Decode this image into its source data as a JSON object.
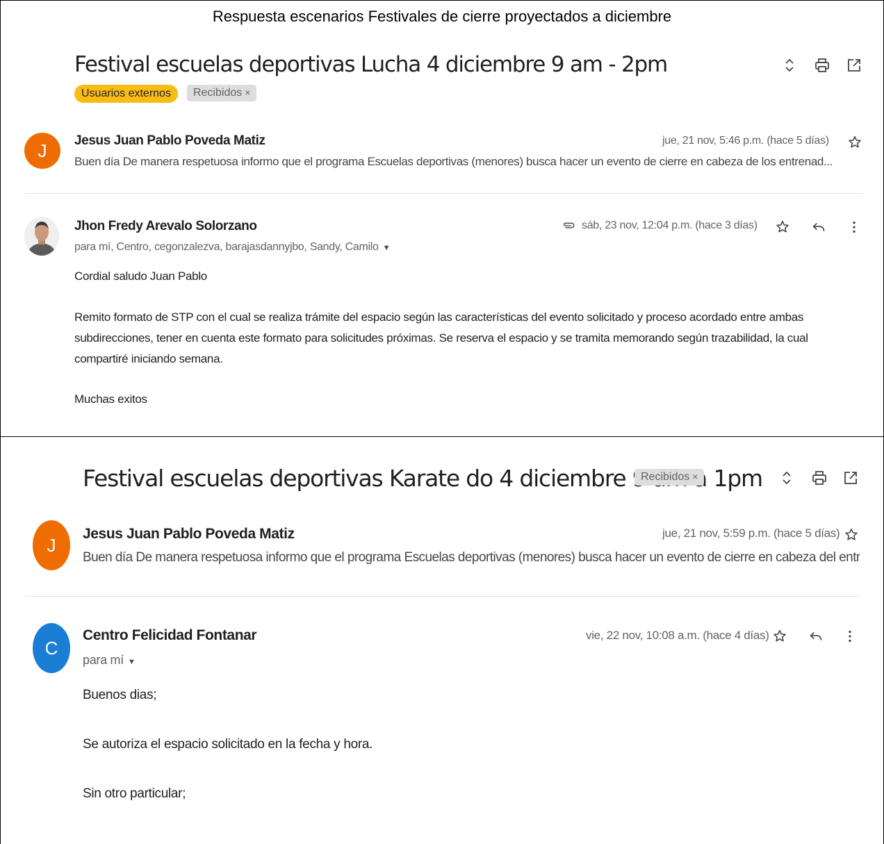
{
  "document_title": "Respuesta escenarios Festivales de cierre proyectados a diciembre",
  "thread1": {
    "subject": "Festival escuelas deportivas Lucha 4 diciembre 9 am - 2pm",
    "labels": {
      "external": "Usuarios externos",
      "inbox": "Recibidos",
      "remove": "×"
    },
    "messages": [
      {
        "avatar_letter": "J",
        "sender": "Jesus Juan Pablo Poveda Matiz",
        "date": "jue, 21 nov, 5:46 p.m. (hace 5 días)",
        "snippet": "Buen día De manera respetuosa informo que el programa Escuelas deportivas (menores) busca hacer un evento de cierre en cabeza de los entrenad..."
      },
      {
        "sender": "Jhon Fredy Arevalo Solorzano",
        "date": "sáb, 23 nov, 12:04 p.m. (hace 3 días)",
        "recipients": "para mí, Centro, cegonzalezva, barajasdannyjbo, Sandy, Camilo",
        "body": [
          "Cordial saludo Juan Pablo",
          "Remito formato de STP con el cual se realiza trámite del espacio según las características del evento solicitado y proceso acordado entre ambas subdirecciones, tener en cuenta este formato para solicitudes próximas. Se reserva el espacio y se tramita memorando según trazabilidad, la cual compartiré iniciando semana.",
          "Muchas exitos"
        ]
      }
    ]
  },
  "thread2": {
    "subject": "Festival escuelas deportivas Karate do 4 diciembre 9 am a 1pm",
    "labels": {
      "inbox": "Recibidos",
      "remove": "×"
    },
    "messages": [
      {
        "avatar_letter": "J",
        "sender": "Jesus Juan Pablo Poveda Matiz",
        "date": "jue, 21 nov, 5:59 p.m. (hace 5 días)",
        "snippet": "Buen día De manera respetuosa informo que el programa Escuelas deportivas (menores) busca hacer un evento de cierre en cabeza del entrenador d..."
      },
      {
        "avatar_letter": "C",
        "sender": "Centro Felicidad Fontanar",
        "date": "vie, 22 nov, 10:08 a.m. (hace 4 días)",
        "recipients": "para mí",
        "body": [
          "Buenos dias;",
          "Se autoriza el espacio solicitado en la fecha y hora.",
          "Sin otro particular;"
        ]
      }
    ]
  },
  "icons": {
    "expand": "unfold-icon",
    "print": "print-icon",
    "open_new": "open-in-new-icon",
    "star": "star-icon",
    "reply": "reply-icon",
    "more": "more-vert-icon",
    "attachment": "attachment-icon",
    "caret": "caret-down-icon"
  },
  "colors": {
    "external_label": "#f9bc15",
    "avatar_orange": "#ef6c00",
    "avatar_blue": "#1a7ed4"
  }
}
